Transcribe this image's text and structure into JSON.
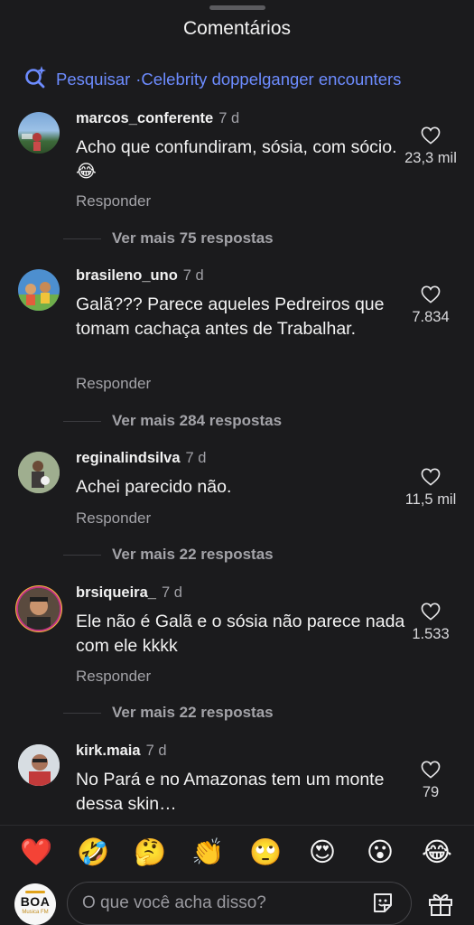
{
  "header": {
    "title": "Comentários"
  },
  "search": {
    "label": "Pesquisar",
    "query": "·Celebrity doppelganger encounters",
    "accent": "#6d8cff"
  },
  "comments": [
    {
      "username": "marcos_conferente",
      "time": "7 d",
      "text": "Acho que confundiram, sósia, com sócio. 😂",
      "reply": "Responder",
      "more": "Ver mais 75 respostas",
      "likes": "23,3 mil"
    },
    {
      "username": "brasileno_uno",
      "time": "7 d",
      "text": "Galã??? Parece aqueles Pedreiros que tomam cachaça antes de Trabalhar.",
      "reply": "Responder",
      "more": "Ver mais 284 respostas",
      "likes": "7.834"
    },
    {
      "username": "reginalindsilva",
      "time": "7 d",
      "text": "Achei parecido não.",
      "reply": "Responder",
      "more": "Ver mais 22 respostas",
      "likes": "11,5 mil"
    },
    {
      "username": "brsiqueira_",
      "time": "7 d",
      "text": "Ele não é Galã e o sósia não parece nada com ele kkkk",
      "reply": "Responder",
      "more": "Ver mais 22 respostas",
      "likes": "1.533"
    },
    {
      "username": "kirk.maia",
      "time": "7 d",
      "text": "No Pará e no Amazonas tem um monte dessa skin…",
      "likes": "79"
    }
  ],
  "reactions": [
    "❤️",
    "🤣",
    "🤔",
    "👏",
    "🙄",
    "😍",
    "😮",
    "😂"
  ],
  "composer": {
    "placeholder": "O que você acha disso?",
    "avatar_text": "BOA",
    "avatar_small": "Musica FM"
  }
}
